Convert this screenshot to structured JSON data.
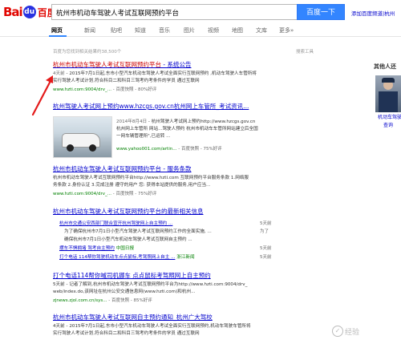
{
  "header": {
    "logo_bai": "Bai",
    "logo_paw": "du",
    "logo_cn": "百度",
    "query": "杭州市机动车驾驶人考试互联网预约平台",
    "search_button": "百度一下",
    "toplinks": "添加百度频道|杭州"
  },
  "nav": {
    "items": [
      "网页",
      "新闻",
      "贴吧",
      "知道",
      "音乐",
      "图片",
      "视频",
      "地图",
      "文库",
      "更多»"
    ]
  },
  "stats": "百度为您找到相关结果约38,500个",
  "tools": "搜索工具",
  "results": [
    {
      "title_hl": "杭州市机动车驾驶人考试互联网预约平台",
      "title_rest": " - 系统公告",
      "abs_date": "4天前",
      "abs_l1": " - 2015年7月1日起,东市小型汽车机动车驾驶人考试全面实行互联网预约 ,机动车驾驶人车管所将",
      "abs_l2": "实行驾驶人考试计划,符合科目二和科目三驾考约考条件的学员 通过互联网",
      "url": "www.hzti.com:9004/drv_...",
      "snap": " - 百度快照 - 80%好评"
    },
    {
      "title": "杭州驾驶人考试网上预约www.hzcgs.gov.cn杭州网上车管所_考试资讯...",
      "abs_date": "2014年8月4日",
      "abs_l1": " - 杭州驾驶人考试网上预约http://www.hzcgs.gov.cn",
      "abs_l2": "杭州网上车管所 网站...驾驶人预约 杭州市机动车车管所网站建立后全国",
      "abs_l3": "一网车辆管理所\",已运转 ...",
      "url": "www.yahoo001.com/artin...",
      "snap": " - 百度快照 - 75%好评"
    },
    {
      "title": "杭州市机动车驾驶人考试互联网预约平台 - 服务条款",
      "abs_l1": "杭州市机动车驾驶人考试互联网预约平台http://www.hzti.com 互联网预约平台服务条款 1.网络服",
      "abs_l2": "务条款 2.身份认证 3.完成注册 遵守的用户 您: 获得本站提供的服务,用户应当...",
      "url": "www.hzti.com:9004/drv_...",
      "snap": " - 百度快照 - 75%好评"
    },
    {
      "title": "杭州市机动车驾驶人考试互联网预约平台的最新相关信息",
      "subs": [
        {
          "text": "杭州市交通公安西部门联合宣开杭州驾驶网上自主预约 ...",
          "source": "",
          "time": "5天前"
        },
        {
          "text": "为了确保杭州市7月1日小型汽车驾驶人考试互联网预约工作的全面实施, ...",
          "source": "",
          "time": "为了"
        },
        {
          "text": "确保杭州市7月1日小型汽车机动车驾驶人考试互联网自主预约 ...",
          "source": "",
          "time": ""
        },
        {
          "text": "摆车不惧拥堵 驾考自主预约",
          "source": "中国日报",
          "time": "5天前"
        },
        {
          "text": "打个电话 114帮你驾驶机动车点点鼠标,考驾照网上自主 ...",
          "source": "浙江新闻",
          "time": "5天前"
        }
      ]
    },
    {
      "title": "打个电话114帮你喊司机挪车 点点鼠标考驾照网上自主预约",
      "abs_l1": "5天前 - 记者了解到,杭州市机动车驾驶人考试互联网预约平台为http://www.hzti.com:9004/drv_",
      "abs_l2": "web/index.do,该网址在杭州公安交通信息网(www.hzti.com)和杭州...",
      "url": "zjnews.zjol.com.cn/sys...",
      "snap": " - 百度快照 - 85%好评"
    },
    {
      "title": "杭州市机动车驾驶人考试互联网自主预约通知_杭州广大驾校",
      "abs_l1": "4天前 - 2015年7月1日起,东市小型汽车机动车驾驶人考试全面实行互联网预约,机动车驾驶车管所将",
      "abs_l2": "实行驾驶人考试计划,符合科目二和科目三驾考约考条件的学员 通过互联网"
    }
  ],
  "right": {
    "title": "其他人还",
    "cap1": "机动车驾驶",
    "cap2": "查询"
  },
  "watermark": {
    "text": "经验",
    "icon": "baidu-jingyan-icon"
  },
  "colors": {
    "link": "#0000cc",
    "highlight": "#cc0000",
    "url": "#008000",
    "button": "#3385ff",
    "arrow": "#e41b1b"
  }
}
